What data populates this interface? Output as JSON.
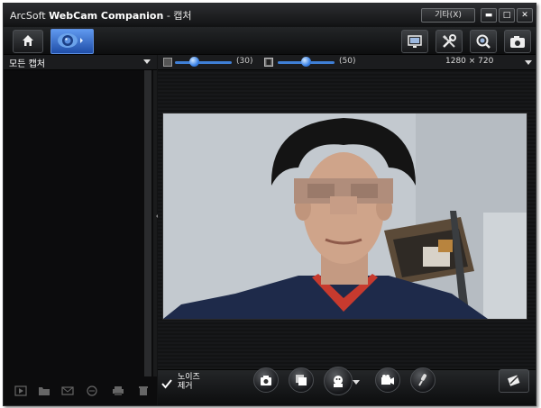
{
  "window": {
    "title_brand_prefix": "ArcSoft",
    "title_brand": "WebCam Companion",
    "title_section": "- 캡처",
    "menu_label": "기타(X)",
    "minimize_symbol": "▬",
    "maximize_symbol": "□",
    "close_symbol": "✕"
  },
  "toolbar": {
    "icons": [
      "home-icon",
      "webcam-icon",
      "screen-icon",
      "settings-tools-icon",
      "zoom-icon",
      "camera-snapshot-icon"
    ]
  },
  "sidebar": {
    "header_label": "모든 캡처",
    "footer_icons": [
      "play-icon",
      "folder-icon",
      "email-icon",
      "share-icon",
      "print-icon",
      "trash-icon"
    ]
  },
  "controls": {
    "brightness_label": "(30)",
    "brightness_value": 30,
    "contrast_label": "(50)",
    "contrast_value": 50,
    "resolution": "1280 × 720"
  },
  "capture_bar": {
    "noise_label_line1": "노이즈",
    "noise_label_line2": "제거",
    "noise_checked": true,
    "buttons": [
      "camera-icon",
      "gallery-icon",
      "face-effects-icon",
      "video-icon",
      "microphone-icon"
    ]
  },
  "colors": {
    "accent": "#3f7fd6",
    "tab_highlight": "#2f62c0",
    "background": "#121314"
  }
}
